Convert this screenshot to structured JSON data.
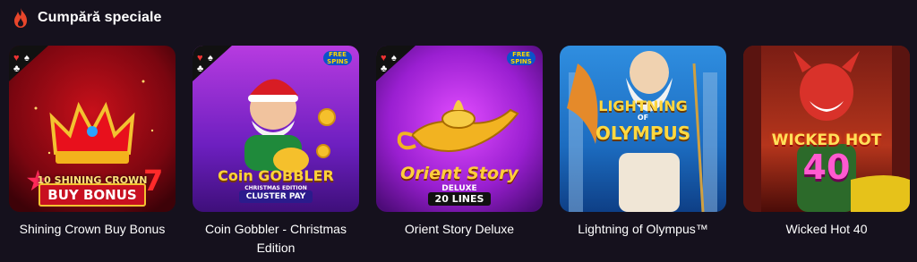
{
  "section": {
    "title": "Cumpără speciale",
    "icon": "fire-icon"
  },
  "games": [
    {
      "name": "Shining Crown Buy Bonus",
      "art": {
        "line1": "10 SHINING CROWN",
        "line2": "BUY BONUS"
      }
    },
    {
      "name": "Coin Gobbler - Christmas Edition",
      "art": {
        "logo": "Coin GOBBLER",
        "sub": "CHRISTMAS EDITION",
        "tag": "CLUSTER PAY",
        "badge": "FREE SPINS"
      }
    },
    {
      "name": "Orient Story Deluxe",
      "art": {
        "logo": "Orient Story",
        "sub": "DELUXE",
        "tag": "20 LINES",
        "badge": "FREE SPINS"
      }
    },
    {
      "name": "Lightning of Olympus™",
      "art": {
        "line1": "LIGHTNING",
        "of": "OF",
        "line2": "OLYMPUS"
      }
    },
    {
      "name": "Wicked Hot 40",
      "art": {
        "line1": "WICKED HOT",
        "line2": "40"
      }
    }
  ],
  "colors": {
    "background": "#15111d",
    "badge": "#0b53c9"
  }
}
